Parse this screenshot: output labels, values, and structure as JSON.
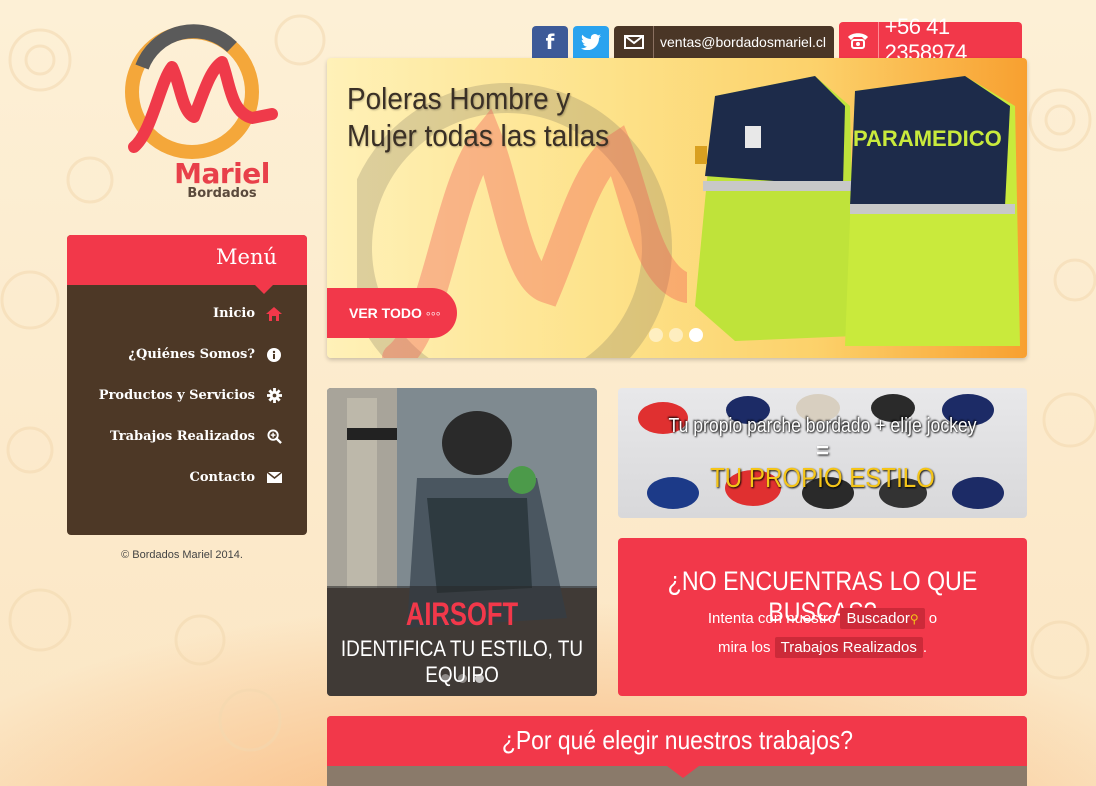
{
  "brand": {
    "name": "Mariel",
    "sub": "Bordados"
  },
  "topbar": {
    "email": "ventas@bordadosmariel.cl",
    "phone": "+56 41 2358974",
    "facebook_icon": "f",
    "twitter_icon": "twitter-bird"
  },
  "slider": {
    "title": "Poleras Hombre y Mujer todas las tallas",
    "button": "VER TODO ◦◦◦",
    "jacket_text": "PARAMEDICO",
    "slides": 3,
    "active_slide": 3
  },
  "menu": {
    "title": "Menú",
    "items": [
      {
        "label": "Inicio",
        "icon": "home-icon"
      },
      {
        "label": "¿Quiénes Somos?",
        "icon": "info-icon"
      },
      {
        "label": "Productos y Servicios",
        "icon": "gear-icon"
      },
      {
        "label": "Trabajos Realizados",
        "icon": "zoom-icon"
      },
      {
        "label": "Contacto",
        "icon": "envelope-icon"
      }
    ]
  },
  "copyright": "© Bordados Mariel 2014.",
  "airsoft": {
    "title": "AIRSOFT",
    "subtitle": "IDENTIFICA TU ESTILO, TU EQUIPO"
  },
  "caps": {
    "line1": "Tu propio parche bordado + elije jockey",
    "line2": "=",
    "line3": "TU PROPIO ESTILO"
  },
  "search": {
    "title": "¿NO ENCUENTRAS LO QUE BUSCAS?",
    "pre": "Intenta con nuestro",
    "link1": "Buscador",
    "post": "o",
    "pre2": "mira los",
    "link2": "Trabajos Realizados",
    "post2": "."
  },
  "why": {
    "title": "¿Por qué elegir nuestros trabajos?"
  },
  "colors": {
    "accent": "#f2384a",
    "menu_bg": "#4d3826",
    "facebook": "#3d5a98",
    "twitter": "#2aa3ef"
  }
}
